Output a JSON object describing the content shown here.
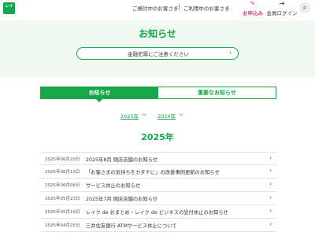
{
  "header": {
    "logo_text": "レイ",
    "nav_links": [
      "ご検討中のお客さま",
      "ご利用中のお客さま"
    ],
    "apply_label": "お申込み",
    "login_label": "会員ログイン",
    "accent_color": "#17a64a",
    "apply_color": "#e6357c"
  },
  "hero": {
    "title": "お知らせ",
    "fraud_banner": "金融犯罪にご注意ください"
  },
  "tabs": [
    {
      "label": "お知らせ",
      "active": true
    },
    {
      "label": "重要なお知らせ",
      "active": false
    }
  ],
  "year_links": [
    "2025年",
    "2024年"
  ],
  "year_heading": "2025年",
  "news": [
    {
      "date": "2025年06月20日",
      "title": "2025年8月 閉店店舗のお知らせ"
    },
    {
      "date": "2025年06月13日",
      "title": "「お客さまの気持ちをカタチに」の改善事例更新のお知らせ"
    },
    {
      "date": "2025年06月06日",
      "title": "サービス休止のお知らせ"
    },
    {
      "date": "2025年05月23日",
      "title": "2025年7月 閉店店舗のお知らせ"
    },
    {
      "date": "2025年05月19日",
      "title": "レイク de おまとめ・レイク de ビジネスの受付休止のお知らせ"
    },
    {
      "date": "2025年04月25日",
      "title": "三井住友銀行 ATMサービス休止について"
    }
  ]
}
